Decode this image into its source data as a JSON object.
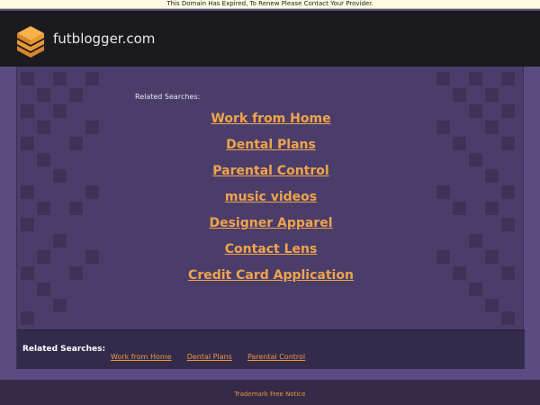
{
  "notice": {
    "text": "This Domain Has Expired, To Renew Please Contact Your Provider."
  },
  "header": {
    "site_name": "futblogger.com",
    "logo_icon": "stacked-layers-icon"
  },
  "main": {
    "related_title": "Related Searches:",
    "links": [
      {
        "label": "Work from Home"
      },
      {
        "label": "Dental Plans"
      },
      {
        "label": "Parental Control"
      },
      {
        "label": "music videos"
      },
      {
        "label": "Designer Apparel"
      },
      {
        "label": "Contact Lens"
      },
      {
        "label": "Credit Card Application"
      }
    ]
  },
  "bottom_bar": {
    "label": "Related Searches:",
    "links": [
      {
        "label": "Work from Home"
      },
      {
        "label": "Dental Plans"
      },
      {
        "label": "Parental Control"
      }
    ]
  },
  "footer": {
    "link": "Trademark Free Notice"
  },
  "colors": {
    "link": "#f0a44a",
    "background": "#5b4b82",
    "header": "#1b1a1f",
    "panel": "#4a3d6a"
  }
}
